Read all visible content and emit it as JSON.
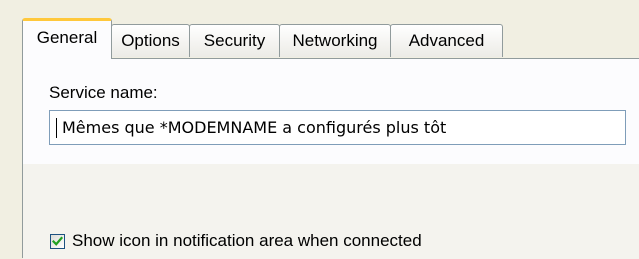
{
  "tabs": [
    {
      "label": "General",
      "active": true
    },
    {
      "label": "Options",
      "active": false
    },
    {
      "label": "Security",
      "active": false
    },
    {
      "label": "Networking",
      "active": false
    },
    {
      "label": "Advanced",
      "active": false
    }
  ],
  "general": {
    "service_name_label": "Service name:",
    "service_name_value": "Mêmes que *MODEMNAME a configurés plus tôt",
    "show_icon_checked": true,
    "show_icon_label": "Show icon in notification area when connected"
  },
  "colors": {
    "window_bg": "#f1efe2",
    "page_bg": "#fcfcfe",
    "active_tab_accent": "#ffc83c",
    "tab_border": "#919b9c",
    "input_border": "#7f9db9",
    "checkmark": "#21a121"
  },
  "icons": {
    "checkbox_mark": "checkmark-icon"
  }
}
